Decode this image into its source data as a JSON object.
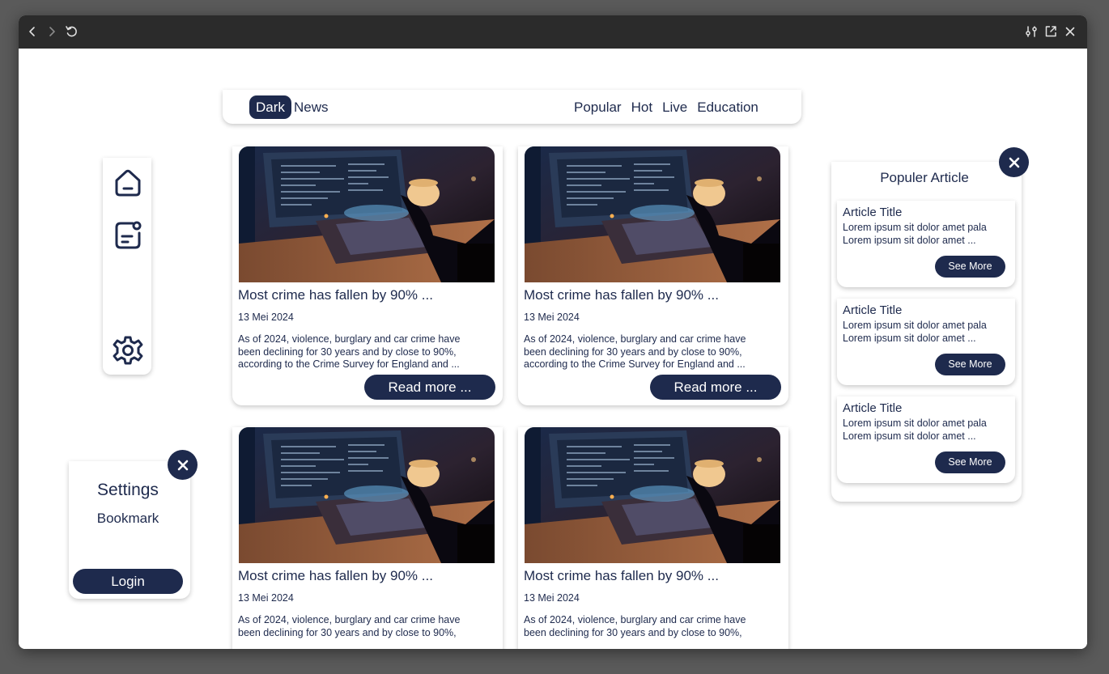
{
  "colors": {
    "accent": "#1e2a4d",
    "titlebar": "#2b2b2b",
    "desktop": "#5a5a5a",
    "background": "#ffffff"
  },
  "titlebar": {
    "left_icons": [
      "back-icon",
      "forward-icon",
      "reload-icon"
    ],
    "right_icons": [
      "tune-icon",
      "open-external-icon",
      "close-icon"
    ]
  },
  "nav": {
    "brand_dark": "Dark",
    "brand_news": "News",
    "links": [
      "Popular",
      "Hot",
      "Live",
      "Education"
    ]
  },
  "sidebar": {
    "icons": [
      "home-icon",
      "notes-icon",
      "settings-gear-icon"
    ]
  },
  "settings_panel": {
    "title": "Settings",
    "bookmark": "Bookmark",
    "login": "Login",
    "close_icon": "close-icon"
  },
  "articles": [
    {
      "image": "hacker-laptop-photo",
      "title": "Most crime has fallen by 90% ...",
      "date": "13 Mei 2024",
      "desc": "As of 2024, violence, burglary and car crime have been declining for 30 years and by close to 90%, according to the Crime Survey for England and ...",
      "button": "Read more ..."
    },
    {
      "image": "hacker-laptop-photo",
      "title": "Most crime has fallen by 90% ...",
      "date": "13 Mei 2024",
      "desc": "As of 2024, violence, burglary and car crime have been declining for 30 years and by close to 90%, according to the Crime Survey for England and ...",
      "button": "Read more ..."
    },
    {
      "image": "hacker-laptop-photo",
      "title": "Most crime has fallen by 90% ...",
      "date": "13 Mei 2024",
      "desc": "As of 2024, violence, burglary and car crime have been declining for 30 years and by close to 90%,",
      "button": ""
    },
    {
      "image": "hacker-laptop-photo",
      "title": "Most crime has fallen by 90% ...",
      "date": "13 Mei 2024",
      "desc": "As of 2024, violence, burglary and car crime have been declining for 30 years and by close to 90%,",
      "button": ""
    }
  ],
  "popular": {
    "title": "Populer Article",
    "items": [
      {
        "title": "Article Title",
        "desc": "Lorem ipsum sit dolor amet pala Lorem ipsum sit dolor amet ...",
        "button": "See More"
      },
      {
        "title": "Article Title",
        "desc": "Lorem ipsum sit dolor amet pala Lorem ipsum sit dolor amet ...",
        "button": "See More"
      },
      {
        "title": "Article Title",
        "desc": "Lorem ipsum sit dolor amet pala Lorem ipsum sit dolor amet ...",
        "button": "See More"
      }
    ]
  }
}
